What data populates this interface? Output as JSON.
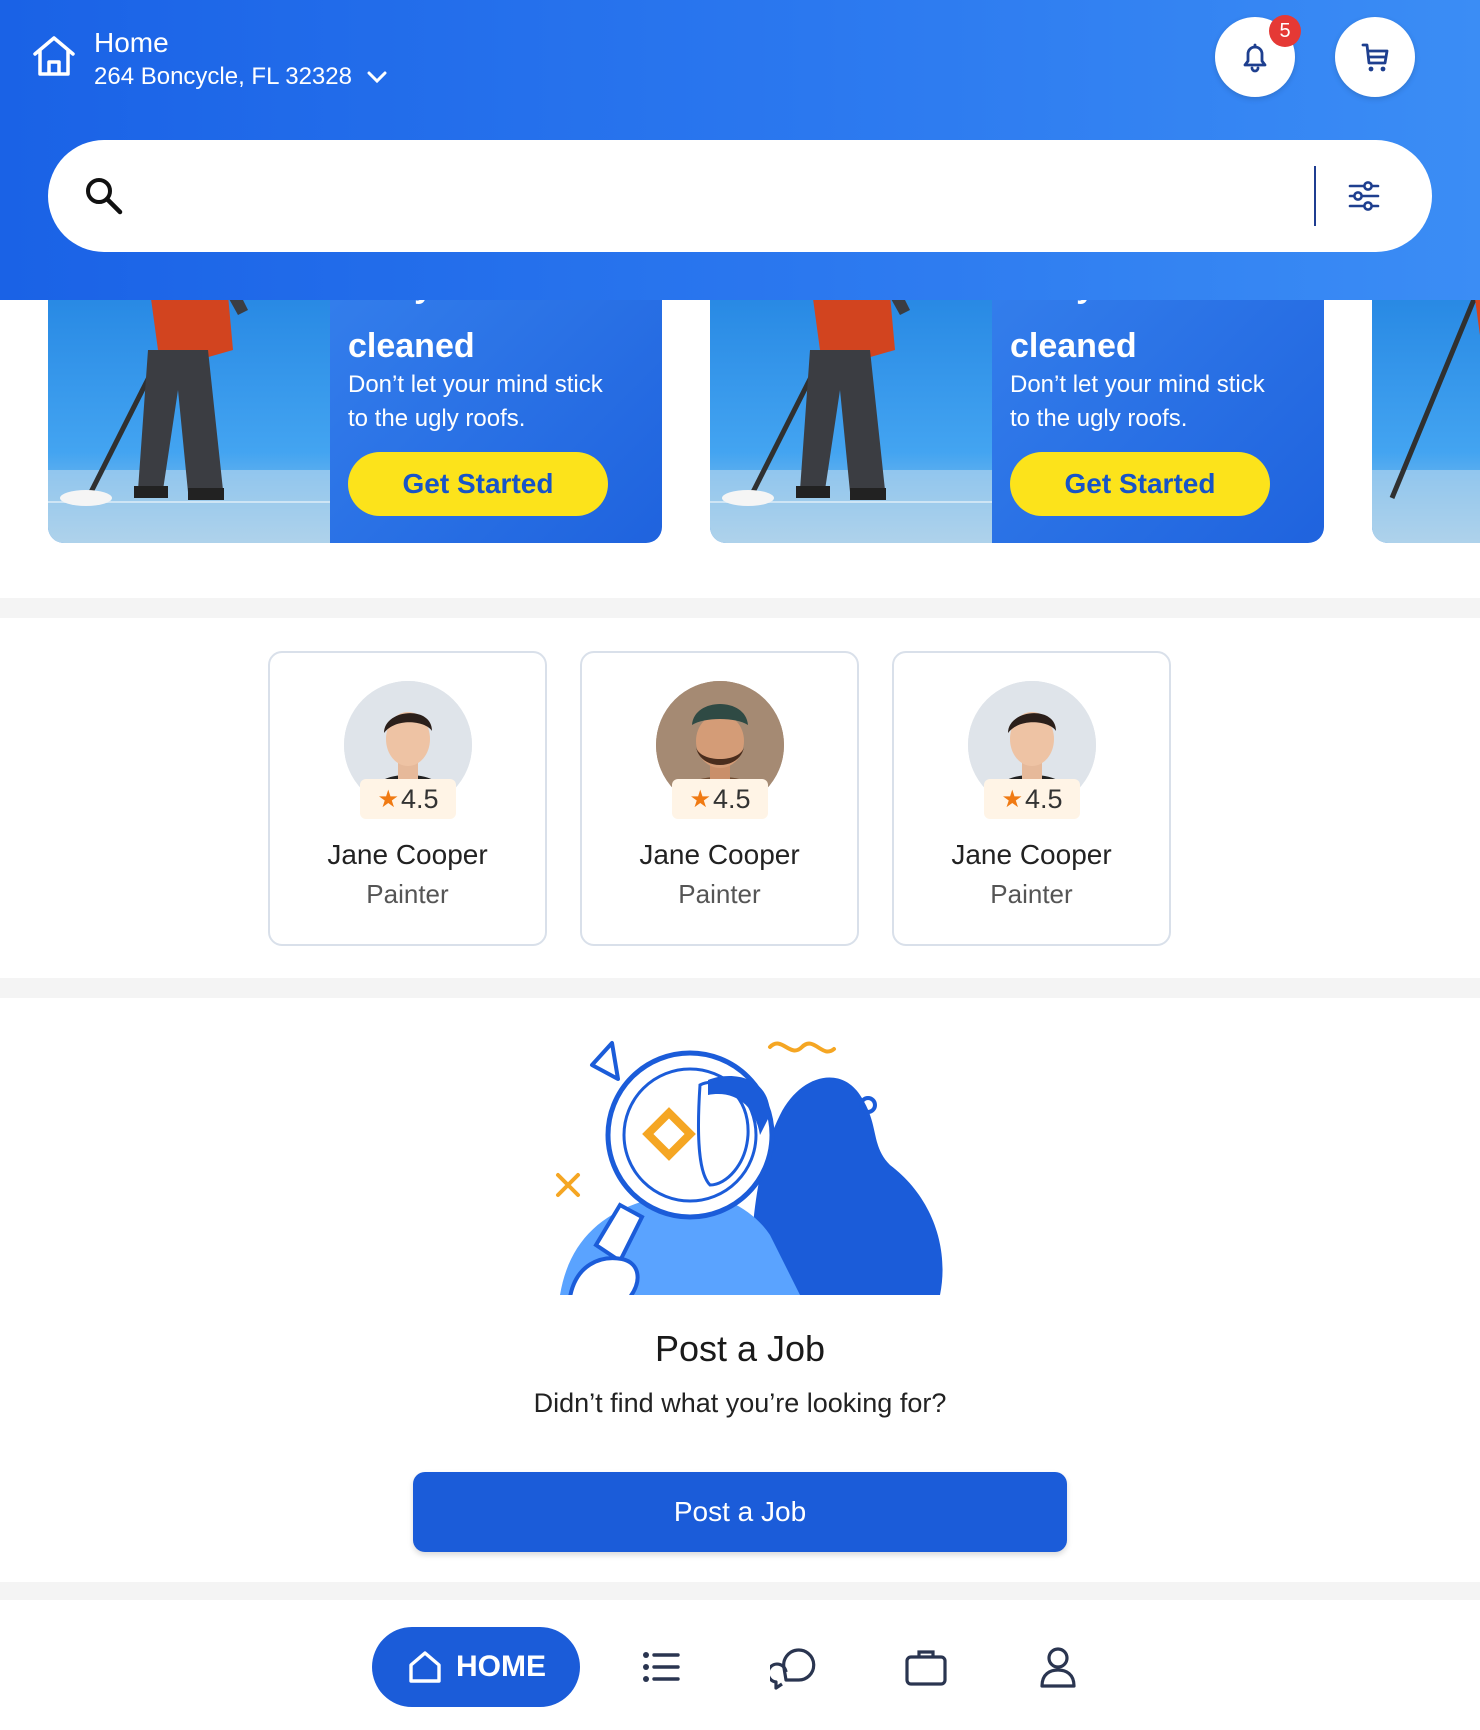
{
  "header": {
    "location_title": "Home",
    "address": "264 Boncycle, FL 32328",
    "notification_count": "5"
  },
  "search": {
    "placeholder": ""
  },
  "banners": [
    {
      "title_cut": "Get your roofs",
      "title": "cleaned",
      "description": "Don’t let your mind stick to the ugly roofs.",
      "button": "Get Started"
    },
    {
      "title_cut": "Get your roofs",
      "title": "cleaned",
      "description": "Don’t let your mind stick to the ugly roofs.",
      "button": "Get Started"
    }
  ],
  "pros": [
    {
      "rating": "4.5",
      "name": "Jane Cooper",
      "role": "Painter"
    },
    {
      "rating": "4.5",
      "name": "Jane Cooper",
      "role": "Painter"
    },
    {
      "rating": "4.5",
      "name": "Jane Cooper",
      "role": "Painter"
    }
  ],
  "post_job": {
    "title": "Post a Job",
    "subtitle": "Didn’t find what you’re looking for?",
    "button": "Post a Job"
  },
  "nav": {
    "home_label": "HOME"
  },
  "colors": {
    "primary": "#1b5cd9",
    "accent_yellow": "#fce31b",
    "badge_red": "#e53935",
    "star": "#f07a13"
  },
  "icons": [
    "home-icon",
    "chevron-down-icon",
    "bell-icon",
    "cart-icon",
    "search-icon",
    "filter-icon",
    "star-icon",
    "list-icon",
    "chat-icon",
    "briefcase-icon",
    "user-icon"
  ]
}
